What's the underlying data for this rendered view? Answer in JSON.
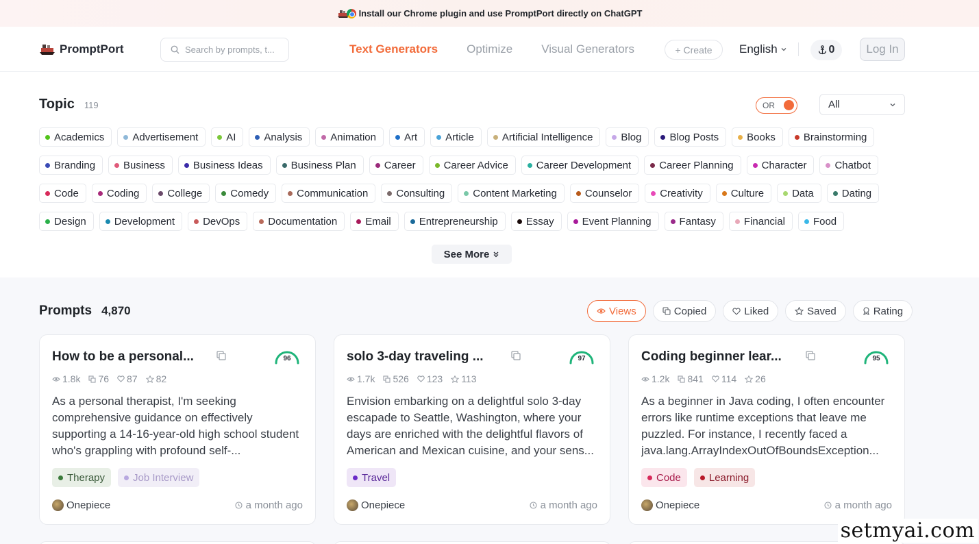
{
  "banner": {
    "text": "Install our Chrome plugin and use PromptPort directly on ChatGPT"
  },
  "header": {
    "logo": "PromptPort",
    "search_placeholder": "Search by prompts, t...",
    "nav": [
      {
        "label": "Text Generators",
        "active": true
      },
      {
        "label": "Optimize",
        "active": false
      },
      {
        "label": "Visual Generators",
        "active": false
      }
    ],
    "create_label": "+ Create",
    "language": "English",
    "points": "0",
    "login_label": "Log In"
  },
  "topic": {
    "title": "Topic",
    "count": "119",
    "toggle_label": "OR",
    "filter_value": "All",
    "see_more": "See More",
    "tags": [
      {
        "label": "Academics",
        "color": "#52c41a"
      },
      {
        "label": "Advertisement",
        "color": "#8fb8d8"
      },
      {
        "label": "AI",
        "color": "#7cc83a"
      },
      {
        "label": "Analysis",
        "color": "#2e5fb5"
      },
      {
        "label": "Animation",
        "color": "#c16aa8"
      },
      {
        "label": "Art",
        "color": "#1f6fc7"
      },
      {
        "label": "Article",
        "color": "#4aa3d8"
      },
      {
        "label": "Artificial Intelligence",
        "color": "#c8b07a"
      },
      {
        "label": "Blog",
        "color": "#c6a8e8"
      },
      {
        "label": "Blog Posts",
        "color": "#2a1a7a"
      },
      {
        "label": "Books",
        "color": "#e8b048"
      },
      {
        "label": "Brainstorming",
        "color": "#c83a2a"
      },
      {
        "label": "Branding",
        "color": "#3a4ab5"
      },
      {
        "label": "Business",
        "color": "#e05a7a"
      },
      {
        "label": "Business Ideas",
        "color": "#3a2aa8"
      },
      {
        "label": "Business Plan",
        "color": "#3a6a6a"
      },
      {
        "label": "Career",
        "color": "#9a2a7a"
      },
      {
        "label": "Career Advice",
        "color": "#7ab82a"
      },
      {
        "label": "Career Development",
        "color": "#2ab0a0"
      },
      {
        "label": "Career Planning",
        "color": "#7a2a4a"
      },
      {
        "label": "Character",
        "color": "#c82ab0"
      },
      {
        "label": "Chatbot",
        "color": "#d890c8"
      },
      {
        "label": "Code",
        "color": "#d82a5a"
      },
      {
        "label": "Coding",
        "color": "#a82a7a"
      },
      {
        "label": "College",
        "color": "#6a4a6a"
      },
      {
        "label": "Comedy",
        "color": "#3a8a3a"
      },
      {
        "label": "Communication",
        "color": "#a86a5a"
      },
      {
        "label": "Consulting",
        "color": "#7a6a6a"
      },
      {
        "label": "Content Marketing",
        "color": "#7ac8a8"
      },
      {
        "label": "Counselor",
        "color": "#b85a1a"
      },
      {
        "label": "Creativity",
        "color": "#e84ab8"
      },
      {
        "label": "Culture",
        "color": "#d8781a"
      },
      {
        "label": "Data",
        "color": "#a8d870"
      },
      {
        "label": "Dating",
        "color": "#3a7a6a"
      },
      {
        "label": "Design",
        "color": "#2ab04a"
      },
      {
        "label": "Development",
        "color": "#1a8ab0"
      },
      {
        "label": "DevOps",
        "color": "#c85a5a"
      },
      {
        "label": "Documentation",
        "color": "#b86a5a"
      },
      {
        "label": "Email",
        "color": "#a81a5a"
      },
      {
        "label": "Entrepreneurship",
        "color": "#1a6a9a"
      },
      {
        "label": "Essay",
        "color": "#1a0a0a"
      },
      {
        "label": "Event Planning",
        "color": "#a81a9a"
      },
      {
        "label": "Fantasy",
        "color": "#9a2a8a"
      },
      {
        "label": "Financial",
        "color": "#e8a8b8"
      },
      {
        "label": "Food",
        "color": "#3ab8e8"
      }
    ]
  },
  "prompts": {
    "title": "Prompts",
    "count": "4,870",
    "sorts": [
      {
        "label": "Views",
        "icon": "eye-icon",
        "active": true
      },
      {
        "label": "Copied",
        "icon": "copy-icon",
        "active": false
      },
      {
        "label": "Liked",
        "icon": "heart-icon",
        "active": false
      },
      {
        "label": "Saved",
        "icon": "star-icon",
        "active": false
      },
      {
        "label": "Rating",
        "icon": "rating-icon",
        "active": false
      }
    ],
    "cards": [
      {
        "title": "How to be a personal...",
        "score": 96,
        "views": "1.8k",
        "copies": "76",
        "likes": "87",
        "saves": "82",
        "desc": "As a personal therapist, I'm seeking comprehensive guidance on effectively supporting a 14-16-year-old high school student who's grappling with profound self-...",
        "tags": [
          {
            "label": "Therapy",
            "bg": "#e8efe6",
            "fg": "#3a5a3a",
            "dot": "#3a7a3a"
          },
          {
            "label": "Job Interview",
            "bg": "#f1eef7",
            "fg": "#a89ac8",
            "dot": "#b8a8e0"
          }
        ],
        "author": "Onepiece",
        "time": "a month ago"
      },
      {
        "title": "solo 3-day traveling ...",
        "score": 97,
        "views": "1.7k",
        "copies": "526",
        "likes": "123",
        "saves": "113",
        "desc": "Envision embarking on a delightful solo 3-day escapade to Seattle, Washington, where your days are enriched with the delightful flavors of American and Mexican cuisine, and your sens...",
        "tags": [
          {
            "label": "Travel",
            "bg": "#efe6f7",
            "fg": "#5a2a9a",
            "dot": "#6a2ac8"
          }
        ],
        "author": "Onepiece",
        "time": "a month ago"
      },
      {
        "title": "Coding beginner lear...",
        "score": 95,
        "views": "1.2k",
        "copies": "841",
        "likes": "114",
        "saves": "26",
        "desc": "As a beginner in Java coding, I often encounter errors like runtime exceptions that leave me puzzled. For instance, I recently faced a java.lang.ArrayIndexOutOfBoundsException...",
        "tags": [
          {
            "label": "Code",
            "bg": "#fbe6ec",
            "fg": "#a81a4a",
            "dot": "#d82a5a"
          },
          {
            "label": "Learning",
            "bg": "#f7e6e6",
            "fg": "#8a1a2a",
            "dot": "#b81a2a"
          }
        ],
        "author": "Onepiece",
        "time": "a month ago"
      }
    ]
  },
  "watermark": "setmyai.com",
  "colors": {
    "accent": "#f26b3a",
    "score_ring": "#1fb47a"
  }
}
